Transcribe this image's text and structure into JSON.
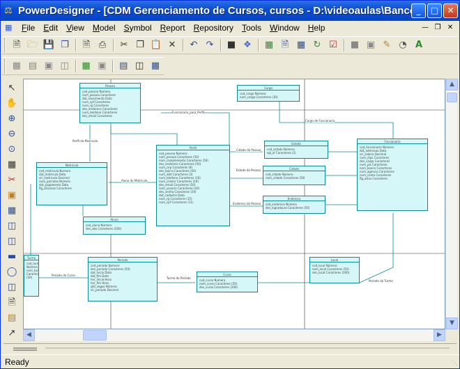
{
  "window": {
    "title": "PowerDesigner - [CDM Gerenciamento de Cursos, cursos - D:\\videoaulas\\Banco de Dados..."
  },
  "menu": [
    "File",
    "Edit",
    "View",
    "Model",
    "Symbol",
    "Report",
    "Repository",
    "Tools",
    "Window",
    "Help"
  ],
  "status": {
    "text": "Ready"
  },
  "toolbar1": [
    "new-icon",
    "open-icon",
    "save-icon",
    "save-all-icon",
    "print-preview-icon",
    "print-icon",
    "cut-icon",
    "copy-icon",
    "paste-icon",
    "delete-icon",
    "undo-icon",
    "redo-icon",
    "model-icon",
    "check-model-icon",
    "package-icon",
    "report-icon",
    "generate-icon",
    "refresh-icon",
    "properties-icon",
    "format-icon",
    "image-icon",
    "pen-icon",
    "fill-icon",
    "text-icon"
  ],
  "toolbar2": [
    "grid-icon",
    "align-icon",
    "layout-icon",
    "fit-icon",
    "diagram-icon",
    "export-icon",
    "zoom-icon",
    "comment-icon",
    "table-icon"
  ],
  "palette": [
    "pointer-icon",
    "hand-icon",
    "zoom-in-icon",
    "zoom-out-icon",
    "zoom-fit-icon",
    "properties-tool-icon",
    "cut-tool-icon",
    "package-tool-icon",
    "entity-icon",
    "inheritance-icon",
    "relationship-icon",
    "association-icon",
    "link-icon",
    "file-icon",
    "note-icon",
    "note-link-icon",
    "line-icon"
  ],
  "entities": [
    {
      "name": "Pessoa",
      "rows": [
        "cod_pessoa  Número",
        "nom_pessoa  Caracteres",
        "dat_nascimento  Data",
        "num_cpf  Caracteres",
        "num_rg  Caracteres",
        "des_endereco  Caracteres",
        "num_telefone  Caracteres",
        "des_email  Caracteres"
      ]
    },
    {
      "name": "Cargo",
      "rows": [
        "cod_cargo  Número",
        "nom_cargo  Caracteres (30)"
      ]
    },
    {
      "name": "Perfil",
      "rows": [
        "cod_pessoa  Número",
        "nom_pessoa  Caracteres (50)",
        "nom_complemento  Caracteres (50)",
        "des_endereco  Caracteres (50)",
        "num_cep  Caracteres (8)",
        "des_bairro  Caracteres (50)",
        "num_ddd  Caracteres (3)",
        "num_telefone  Caracteres (10)",
        "num_celular  Caracteres (10)",
        "des_email  Caracteres (50)",
        "nom_usuario  Caracteres (20)",
        "des_senha  Caracteres (20)",
        "dat_cadastro  Data",
        "num_rg  Caracteres (15)",
        "num_cpf  Caracteres (11)"
      ]
    },
    {
      "name": "Matricula",
      "rows": [
        "cod_matricula  Número",
        "dat_matricula  Data",
        "vlr_matricula  Decimal",
        "num_parcelas  Número",
        "dat_pagamento  Data",
        "flg_situacao  Caracteres"
      ]
    },
    {
      "name": "Aluno",
      "rows": [
        "cod_aluno  Número",
        "des_obs  Caracteres (200)"
      ]
    },
    {
      "name": "Estado",
      "rows": [
        "cod_estado  Número",
        "sgl_uf  Caracteres (2)"
      ]
    },
    {
      "name": "Cidade",
      "rows": [
        "cod_cidade  Número",
        "nom_cidade  Caracteres (50)"
      ]
    },
    {
      "name": "Endereco",
      "rows": [
        "cod_endereco  Número",
        "des_logradouro  Caracteres (50)"
      ]
    },
    {
      "name": "Funcionario",
      "rows": [
        "cod_funcionario  Número",
        "dat_admissao  Data",
        "vlr_salario  Decimal",
        "num_ctps  Caracteres",
        "des_cargo  Caracteres",
        "num_pis  Caracteres",
        "nom_banco  Caracteres",
        "num_agencia  Caracteres",
        "num_conta  Caracteres",
        "flg_ativo  Caracteres"
      ]
    },
    {
      "name": "Periodo",
      "rows": [
        "cod_periodo  Número",
        "des_periodo  Caracteres (50)",
        "dat_inicio  Data",
        "dat_fim  Data",
        "hor_inicio  Hora",
        "hor_fim  Hora",
        "qtd_vagas  Número",
        "vlr_periodo  Decimal"
      ]
    },
    {
      "name": "Curso",
      "rows": [
        "cod_curso  Número",
        "nom_curso  Caracteres (50)",
        "des_curso  Caracteres (200)"
      ]
    },
    {
      "name": "Turma",
      "rows": [
        "cod_turma  Número",
        "nom_turma  Caracteres (30)"
      ]
    },
    {
      "name": "Local",
      "rows": [
        "cod_local  Número",
        "nom_local  Caracteres (50)",
        "des_local  Caracteres (200)"
      ]
    }
  ],
  "links": [
    "Funcionario_para_Perfil",
    "Perfil da Matricula",
    "Aluno do Matricula",
    "Cidade da Pessoa",
    "Estado da Pessoa",
    "Endereco da Pessoa",
    "Cargo de Funcionario",
    "Periodo do Curso",
    "Turma do Periodo",
    "Periodo do Turma"
  ]
}
